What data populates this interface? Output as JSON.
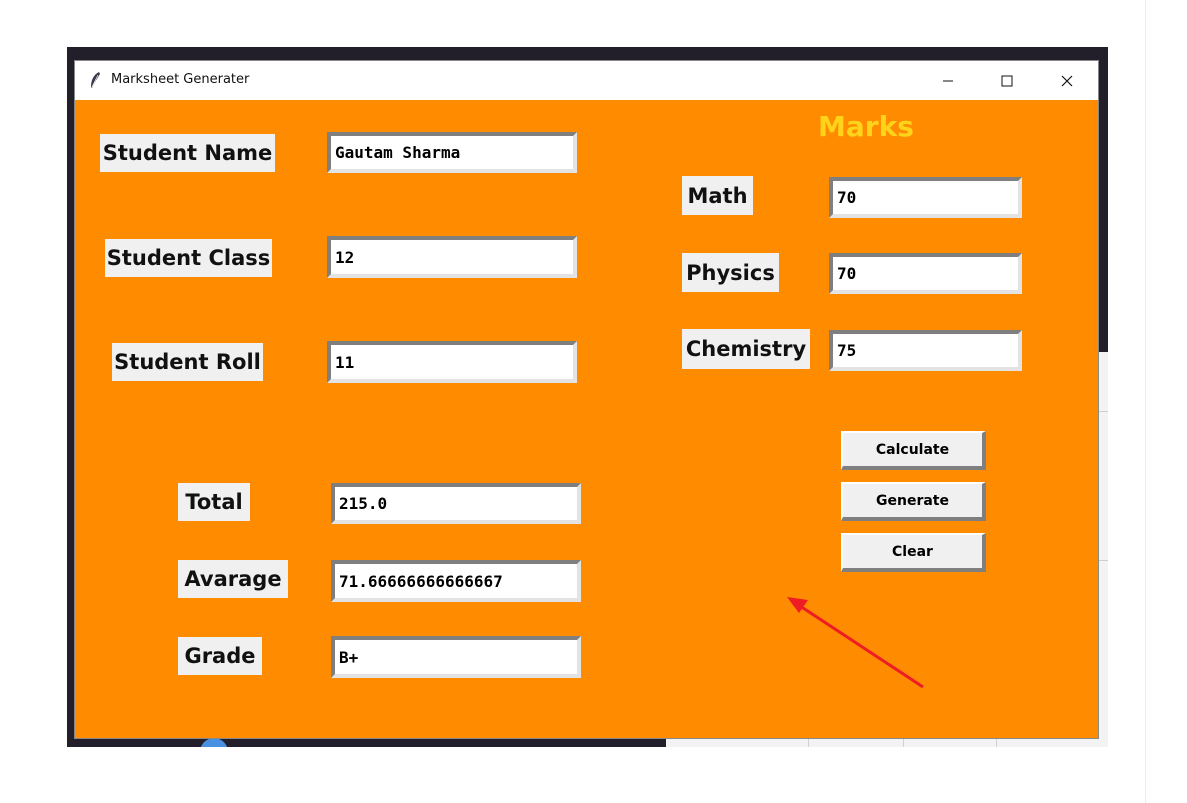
{
  "window": {
    "title": "Marksheet Generater"
  },
  "student": {
    "name_label": "Student Name",
    "name_value": "Gautam Sharma",
    "class_label": "Student Class",
    "class_value": "12",
    "roll_label": "Student Roll",
    "roll_value": "11"
  },
  "results": {
    "total_label": "Total",
    "total_value": "215.0",
    "average_label": "Avarage",
    "average_value": "71.66666666666667",
    "grade_label": "Grade",
    "grade_value": "B+"
  },
  "marks": {
    "title": "Marks",
    "math_label": "Math",
    "math_value": "70",
    "physics_label": "Physics",
    "physics_value": "70",
    "chemistry_label": "Chemistry",
    "chemistry_value": "75"
  },
  "buttons": {
    "calculate": "Calculate",
    "generate": "Generate",
    "clear": "Clear"
  },
  "colors": {
    "background": "#ff8c00",
    "marks_title": "#ffd31a",
    "arrow": "#ee1c24"
  },
  "icons": {
    "app": "feather-icon",
    "minimize": "minimize-icon",
    "maximize": "maximize-icon",
    "close": "close-icon",
    "annotation": "red-arrow-icon"
  }
}
